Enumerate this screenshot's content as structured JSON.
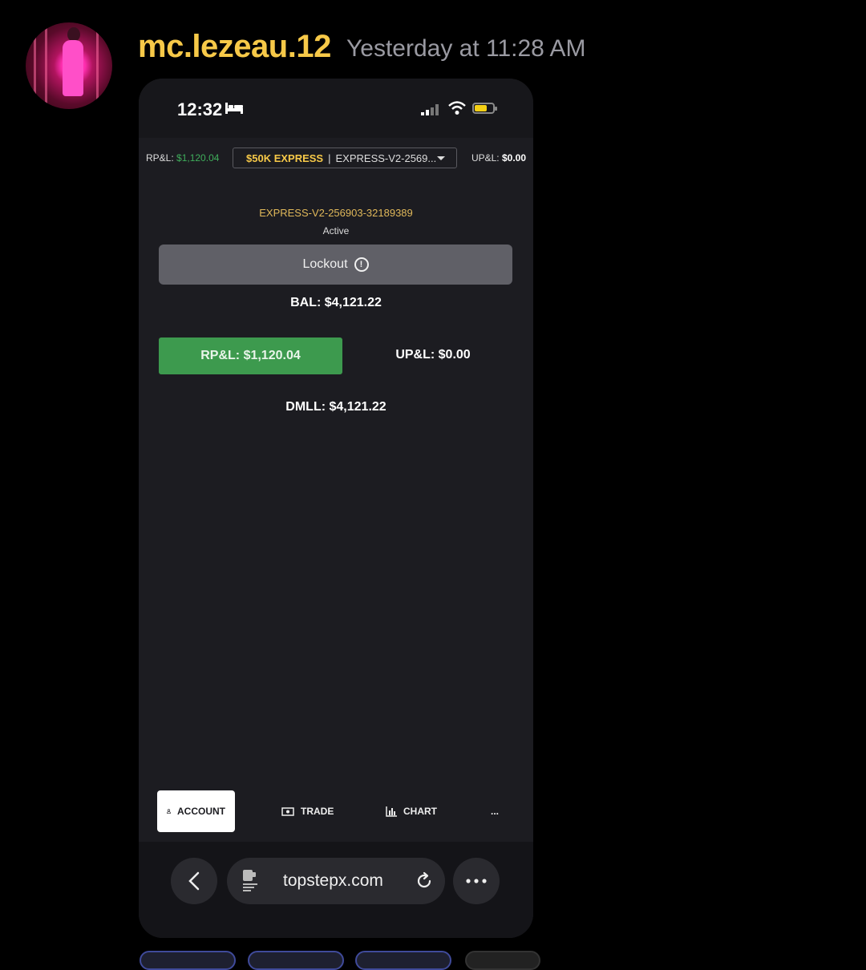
{
  "message": {
    "username": "mc.lezeau.12",
    "timestamp": "Yesterday at 11:28 AM",
    "username_color": "#f7c948"
  },
  "phone": {
    "status_bar": {
      "time": "12:32",
      "icons": [
        "bed-icon",
        "cellular-signal-icon",
        "wifi-icon",
        "battery-icon"
      ]
    },
    "top_bar": {
      "rpl_label": "RP&L:",
      "rpl_value": "$1,120.04",
      "account_tier": "$50K EXPRESS",
      "account_separator": "|",
      "account_short": "EXPRESS-V2-2569...",
      "upl_label": "UP&L:",
      "upl_value": "$0.00"
    },
    "account": {
      "id": "EXPRESS-V2-256903-32189389",
      "status": "Active",
      "lockout_label": "Lockout",
      "balance": "BAL: $4,121.22",
      "rpl": "RP&L: $1,120.04",
      "upl": "UP&L: $0.00",
      "dmll": "DMLL: $4,121.22"
    },
    "nav": {
      "items": [
        {
          "label": "ACCOUNT",
          "icon": "person-icon",
          "active": true
        },
        {
          "label": "TRADE",
          "icon": "money-icon",
          "active": false
        },
        {
          "label": "CHART",
          "icon": "chart-icon",
          "active": false
        },
        {
          "label": "...",
          "icon": "more-icon",
          "active": false
        }
      ]
    },
    "browser": {
      "url": "topstepx.com"
    },
    "colors": {
      "accent_gold": "#f7c948",
      "profit_green": "#3d9a4e",
      "background": "#1c1c21"
    }
  }
}
